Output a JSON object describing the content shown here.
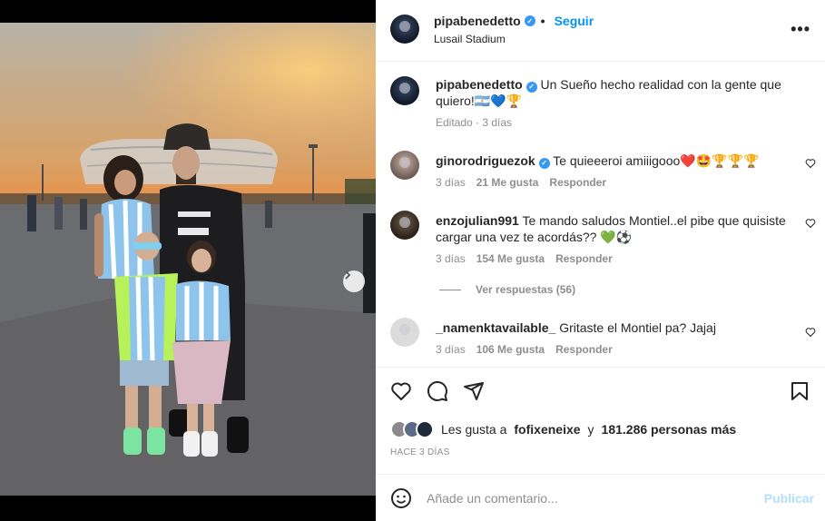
{
  "post": {
    "username": "pipabenedetto",
    "verified": true,
    "follow_label": "Seguir",
    "separator": "•",
    "location": "Lusail Stadium",
    "more_icon": "more-horizontal-icon",
    "carousel": {
      "dot_count": 6,
      "active_index": 0
    }
  },
  "caption": {
    "username": "pipabenedetto",
    "text": "Un Sueño hecho realidad con la gente que quiero!🇦🇷💙🏆",
    "meta": "Editado · 3 días"
  },
  "comments": [
    {
      "username": "ginorodriguezok",
      "verified": true,
      "text": "Te quieeeroi amiiigooo❤️🤩🏆🏆🏆",
      "age": "3 días",
      "likes": "21 Me gusta",
      "reply": "Responder"
    },
    {
      "username": "enzojulian991",
      "verified": false,
      "text": "Te mando saludos Montiel..el pibe que quisiste cargar una vez te acordás?? 💚⚽",
      "age": "3 días",
      "likes": "154 Me gusta",
      "reply": "Responder",
      "view_replies": "Ver respuestas (56)"
    },
    {
      "username": "_namenktavailable_",
      "verified": false,
      "text": "Gritaste el Montiel pa? Jajaj",
      "age": "3 días",
      "likes": "106 Me gusta",
      "reply": "Responder"
    }
  ],
  "actions": {
    "likes_prefix": "Les gusta a",
    "likes_user": "fofixeneixe",
    "likes_conj": "y",
    "likes_count": "181.286 personas más",
    "timestamp": "Hace 3 días"
  },
  "composer": {
    "placeholder": "Añade un comentario...",
    "publish_label": "Publicar"
  },
  "colors": {
    "link": "#0095f6",
    "muted": "#8e8e8e",
    "text": "#262626",
    "publish_disabled": "#b2dffc"
  }
}
